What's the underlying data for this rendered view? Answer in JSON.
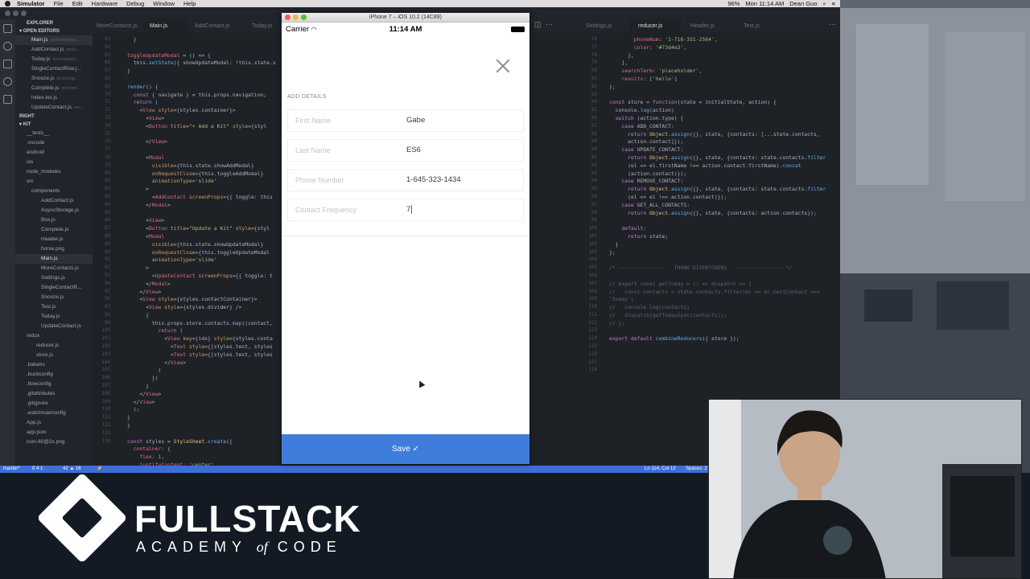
{
  "menubar": {
    "app": "Simulator",
    "items": [
      "File",
      "Edit",
      "Hardware",
      "Debug",
      "Window",
      "Help"
    ],
    "battery": "96%",
    "datetime": "Mon 11:14 AM",
    "user": "Dean Guo"
  },
  "sidebar": {
    "explorer_label": "EXPLORER",
    "open_editors_label": "OPEN EDITORS",
    "open_editors": [
      {
        "name": "Main.js",
        "path": "src/compone..."
      },
      {
        "name": "AddContact.js",
        "path": "src/c..."
      },
      {
        "name": "Today.js",
        "path": "src/compon..."
      },
      {
        "name": "SingleContactRow.j...",
        "path": ""
      },
      {
        "name": "Snooze.js",
        "path": "src/comp..."
      },
      {
        "name": "Complete.js",
        "path": "src/com..."
      },
      {
        "name": "index.ios.js",
        "path": ""
      },
      {
        "name": "UpdateContact.js",
        "path": "src..."
      }
    ],
    "right_label": "RIGHT",
    "kit_label": "KIT",
    "tree": [
      "__tests__",
      ".vscode",
      "android",
      "ios",
      "node_modules",
      "src",
      "components",
      "AddContact.js",
      "AsyncStorage.js",
      "Box.js",
      "Complete.js",
      "Header.js",
      "horse.png",
      "Main.js",
      "MoreContacts.js",
      "Settings.js",
      "SingleContactR...",
      "Snooze.js",
      "Test.js",
      "Today.js",
      "UpdateContact.js",
      "redux",
      "reducer.js",
      "store.js",
      ".babelrc",
      ".buckconfig",
      ".flowconfig",
      ".gitattributes",
      ".gitignore",
      ".watchmanconfig",
      "App.js",
      "app.json",
      "icon-60@2x.png"
    ]
  },
  "tabs_left": [
    "MoreContacts.js",
    "Main.js",
    "AddContact.js",
    "Today.js"
  ],
  "tabs_right": [
    "Settings.js",
    "reducer.js",
    "Header.js",
    "Test.js"
  ],
  "statusbar": {
    "branch": "master*",
    "sync": "0 4 1",
    "problems": "42 ▲ 16",
    "position": "Ln 114, Col 13",
    "spaces": "Spaces: 2"
  },
  "simulator": {
    "window_title": "iPhone 7 – iOS 10.2 (14C89)",
    "carrier": "Carrier",
    "time": "11:14 AM",
    "section_label": "ADD DETAILS",
    "fields": [
      {
        "label": "First Name",
        "value": "Gabe"
      },
      {
        "label": "Last Name",
        "value": "ES6"
      },
      {
        "label": "Phone Number",
        "value": "1-645-323-1434"
      },
      {
        "label": "Contact Frequency",
        "value": "7"
      }
    ],
    "save_label": "Save ✓"
  },
  "brand": {
    "line1": "FULLSTACK",
    "line2_a": "ACADEMY",
    "line2_of": "of",
    "line2_b": "CODE"
  }
}
